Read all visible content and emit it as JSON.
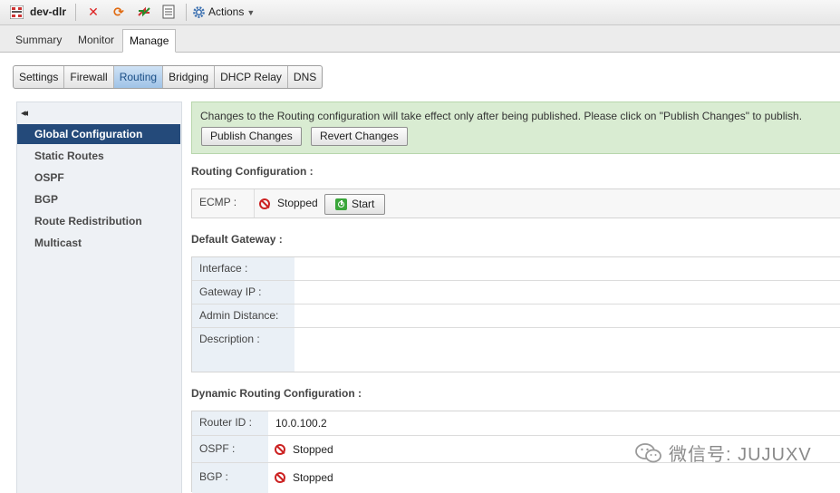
{
  "titlebar": {
    "title": "dev-dlr",
    "actions_label": "Actions"
  },
  "tabs": [
    {
      "label": "Summary"
    },
    {
      "label": "Monitor"
    },
    {
      "label": "Manage",
      "active": true
    }
  ],
  "subtabs": [
    {
      "label": "Settings"
    },
    {
      "label": "Firewall"
    },
    {
      "label": "Routing",
      "active": true
    },
    {
      "label": "Bridging"
    },
    {
      "label": "DHCP Relay"
    },
    {
      "label": "DNS"
    }
  ],
  "sidebar": {
    "collapse_glyph": "◂◂",
    "items": [
      {
        "label": "Global Configuration",
        "active": true
      },
      {
        "label": "Static Routes"
      },
      {
        "label": "OSPF"
      },
      {
        "label": "BGP"
      },
      {
        "label": "Route Redistribution"
      },
      {
        "label": "Multicast"
      }
    ]
  },
  "banner": {
    "message": "Changes to the Routing configuration will take effect only after being published. Please click on \"Publish Changes\" to publish.",
    "publish_label": "Publish Changes",
    "revert_label": "Revert Changes"
  },
  "routing_config": {
    "title": "Routing Configuration :",
    "ecmp_label": "ECMP :",
    "ecmp_status": "Stopped",
    "start_label": "Start"
  },
  "default_gateway": {
    "title": "Default Gateway :",
    "interface_label": "Interface :",
    "gateway_ip_label": "Gateway IP :",
    "admin_distance_label": "Admin Distance:",
    "description_label": "Description :"
  },
  "dynamic_routing": {
    "title": "Dynamic Routing Configuration :",
    "router_id_label": "Router ID :",
    "router_id_value": "10.0.100.2",
    "ospf_label": "OSPF :",
    "ospf_status": "Stopped",
    "bgp_label": "BGP :",
    "bgp_status": "Stopped"
  },
  "watermark": {
    "text": "微信号: JUJUXV"
  },
  "colors": {
    "accent": "#244a7a",
    "banner_bg": "#d9ecd2",
    "stopped": "#cc2222",
    "start_green": "#3aa63a"
  }
}
